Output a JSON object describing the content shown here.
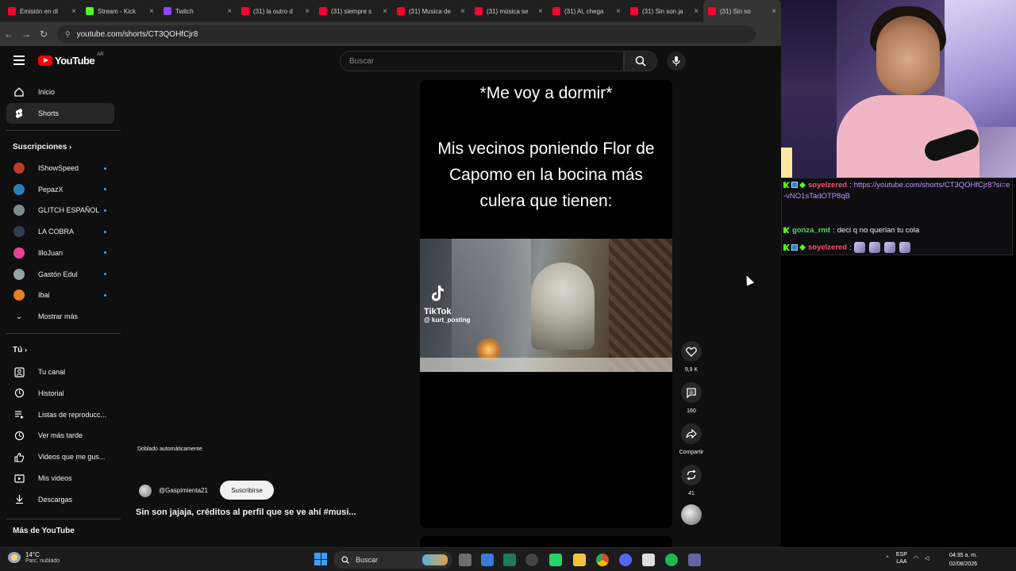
{
  "browser": {
    "tabs": [
      {
        "title": "Emisión en di",
        "favicon_color": "#ff0033"
      },
      {
        "title": "Stream - Kick",
        "favicon_color": "#53fc18"
      },
      {
        "title": "Twitch",
        "favicon_color": "#9146ff"
      },
      {
        "title": "(31) la outro d",
        "favicon_color": "#ff0033"
      },
      {
        "title": "(31) siempre s",
        "favicon_color": "#ff0033"
      },
      {
        "title": "(31) Musica de",
        "favicon_color": "#ff0033"
      },
      {
        "title": "(31) música se",
        "favicon_color": "#ff0033"
      },
      {
        "title": "(31) Al, chega",
        "favicon_color": "#ff0033"
      },
      {
        "title": "(31) Sin son ja",
        "favicon_color": "#ff0033"
      },
      {
        "title": "(31) Sin so",
        "favicon_color": "#ff0033"
      }
    ],
    "close_glyph": "×",
    "url": "youtube.com/shorts/CT3QOHfCjr8"
  },
  "header": {
    "logo_text": "YouTube",
    "country_code": "AR",
    "search_placeholder": "Buscar"
  },
  "sidebar": {
    "top_items": [
      {
        "label": "Inicio",
        "icon": "home-icon",
        "active": false
      },
      {
        "label": "Shorts",
        "icon": "shorts-icon",
        "active": true
      }
    ],
    "subscriptions_heading": "Suscripciones",
    "subscriptions": [
      {
        "label": "IShowSpeed",
        "avatar_color": "#c0392b"
      },
      {
        "label": "PepazX",
        "avatar_color": "#2980b9"
      },
      {
        "label": "GLITCH ESPAÑOL",
        "avatar_color": "#7f8c8d"
      },
      {
        "label": "LA COBRA",
        "avatar_color": "#2c3e50"
      },
      {
        "label": "IlloJuan",
        "avatar_color": "#e84393"
      },
      {
        "label": "Gastón Edul",
        "avatar_color": "#95a5a6"
      },
      {
        "label": "Ibai",
        "avatar_color": "#e67e22"
      }
    ],
    "show_more": "Mostrar más",
    "you_heading": "Tú",
    "you_items": [
      {
        "label": "Tu canal",
        "icon": "channel-icon"
      },
      {
        "label": "Historial",
        "icon": "history-icon"
      },
      {
        "label": "Listas de reproducc...",
        "icon": "playlist-icon"
      },
      {
        "label": "Ver más tarde",
        "icon": "clock-icon"
      },
      {
        "label": "Videos que me gus...",
        "icon": "like-icon"
      },
      {
        "label": "Mis videos",
        "icon": "video-icon"
      },
      {
        "label": "Descargas",
        "icon": "download-icon"
      }
    ],
    "more_heading": "Más de YouTube"
  },
  "short": {
    "caption_top": "*Me voy a dormir*",
    "caption_main": "Mis vecinos poniendo Flor de Capomo en la bocina más culera que tienen:",
    "watermark_brand": "TikTok",
    "watermark_user": "@ kurt_posting",
    "dubbed_label": "Doblado automáticamente",
    "channel_handle": "@Gaspimienta21",
    "subscribe_label": "Suscribirse",
    "title": "Sin son jajaja, créditos al perfil que se ve ahí #musi..."
  },
  "actions": {
    "like_count": "9,9 K",
    "comment_count": "160",
    "share_label": "Compartir",
    "remix_count": "41"
  },
  "chat": {
    "messages": [
      {
        "user": "soyelzered",
        "user_color": "red",
        "text": "https://youtube.com/shorts/CT3QOHfCjr8?si=e-vNO1sTadOTP8qB",
        "is_link": true
      },
      {
        "user": "gonza_rmt",
        "user_color": "green",
        "text": "deci q no querian tu cola",
        "is_link": false
      },
      {
        "user": "soyelzered",
        "user_color": "red",
        "text": "",
        "emote_count": 4
      }
    ],
    "separator": ":"
  },
  "taskbar": {
    "temperature": "14°C",
    "weather": "Parc. nublado",
    "search_label": "Buscar",
    "lang_top": "ESP",
    "lang_bottom": "LAA",
    "time": "04:35 a. m.",
    "date": "02/08/2026"
  }
}
